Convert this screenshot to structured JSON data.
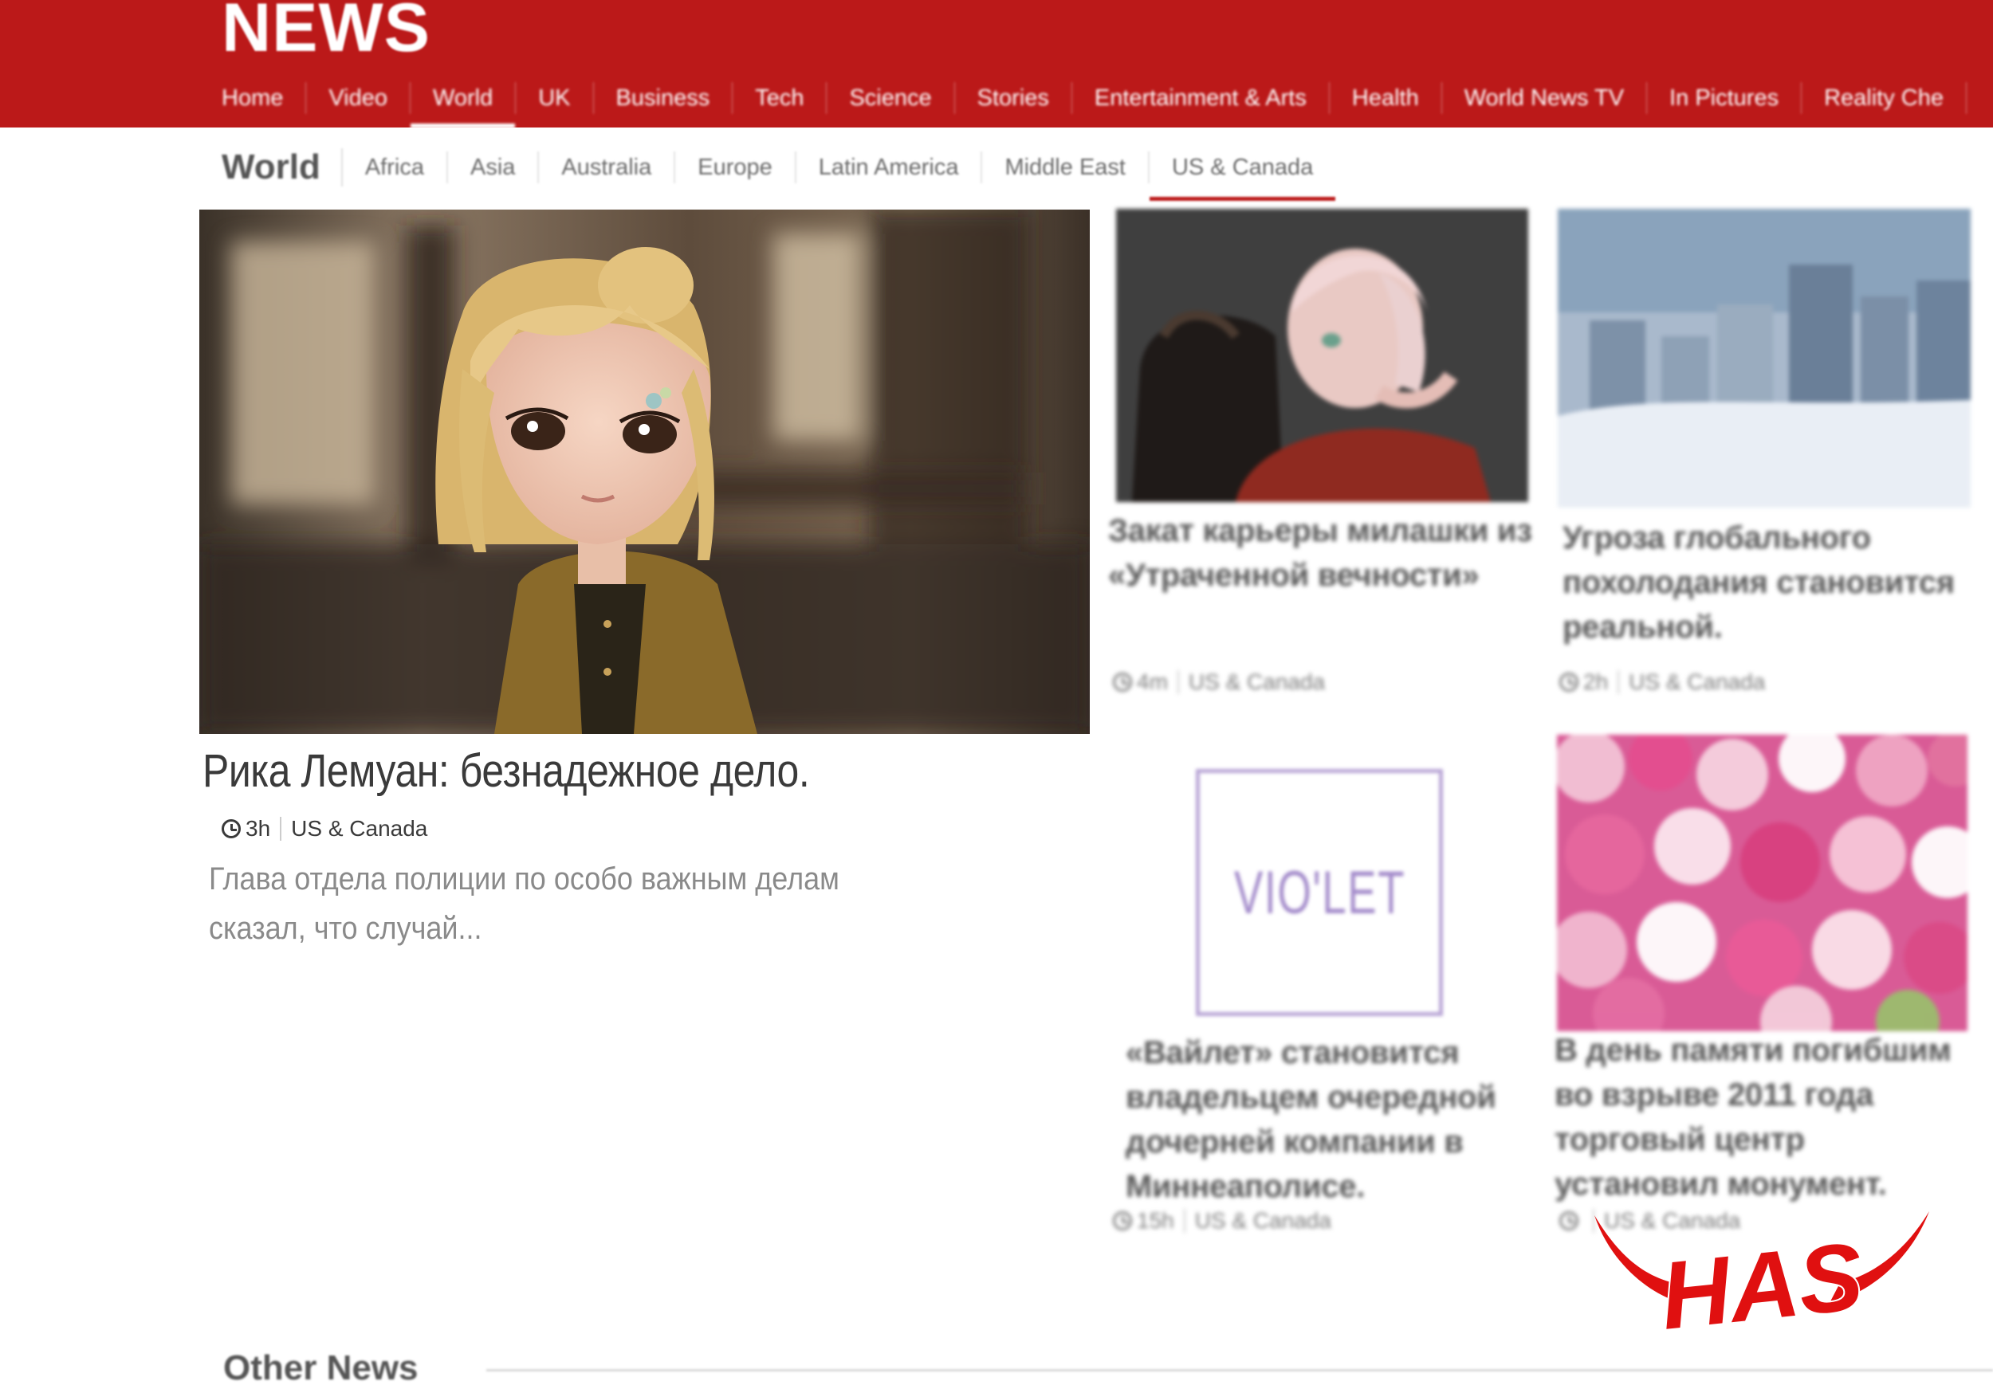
{
  "header": {
    "logo": "NEWS",
    "nav": [
      "Home",
      "Video",
      "World",
      "UK",
      "Business",
      "Tech",
      "Science",
      "Stories",
      "Entertainment & Arts",
      "Health",
      "World News TV",
      "In Pictures",
      "Reality Che"
    ],
    "active_nav": "World",
    "brand_color": "#bb1919"
  },
  "subnav": {
    "section_title": "World",
    "items": [
      "Africa",
      "Asia",
      "Australia",
      "Europe",
      "Latin America",
      "Middle East",
      "US & Canada"
    ],
    "active": "US & Canada"
  },
  "main_story": {
    "title": "Рика Лемуан: безнадежное дело.",
    "time": "3h",
    "section": "US & Canada",
    "summary": "Глава отдела полиции по особо важным делам сказал, что случай..."
  },
  "stories": [
    {
      "title": "Закат карьеры милашки из «Утраченной вечности»",
      "time": "4m",
      "section": "US & Canada"
    },
    {
      "title": "Угроза глобального похолодания становится реальной.",
      "time": "2h",
      "section": "US & Canada"
    },
    {
      "title": "«Вайлет» становится владельцем очередной дочерней компании в Миннеаполисе.",
      "time": "15h",
      "section": "US & Canada",
      "image_text": "VIO'LET"
    },
    {
      "title": "В день памяти погибшим во взрыве 2011 года торговый центр установил монумент.",
      "time": "",
      "section": "US & Canada"
    }
  ],
  "other_news": {
    "label": "Other News"
  },
  "watermark": {
    "text": "HAS",
    "color": "#e01010"
  },
  "icons": {
    "clock": "clock-icon"
  }
}
